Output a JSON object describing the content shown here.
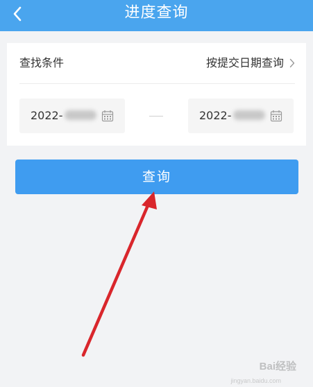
{
  "header": {
    "title": "进度查询",
    "back_icon": "chevron-left-icon",
    "bg_color": "#4aa5ee"
  },
  "search": {
    "condition_label": "查找条件",
    "condition_value": "按提交日期查询",
    "start_date_visible": "2022-",
    "end_date_visible": "2022-",
    "calendar_icon": "calendar-icon",
    "range_separator": "—"
  },
  "actions": {
    "query_label": "查询",
    "button_color": "#3f9cf0"
  },
  "annotation": {
    "arrow_color": "#d9262c"
  },
  "watermark": {
    "brand": "Bai经验",
    "url": "jingyan.baidu.com"
  }
}
